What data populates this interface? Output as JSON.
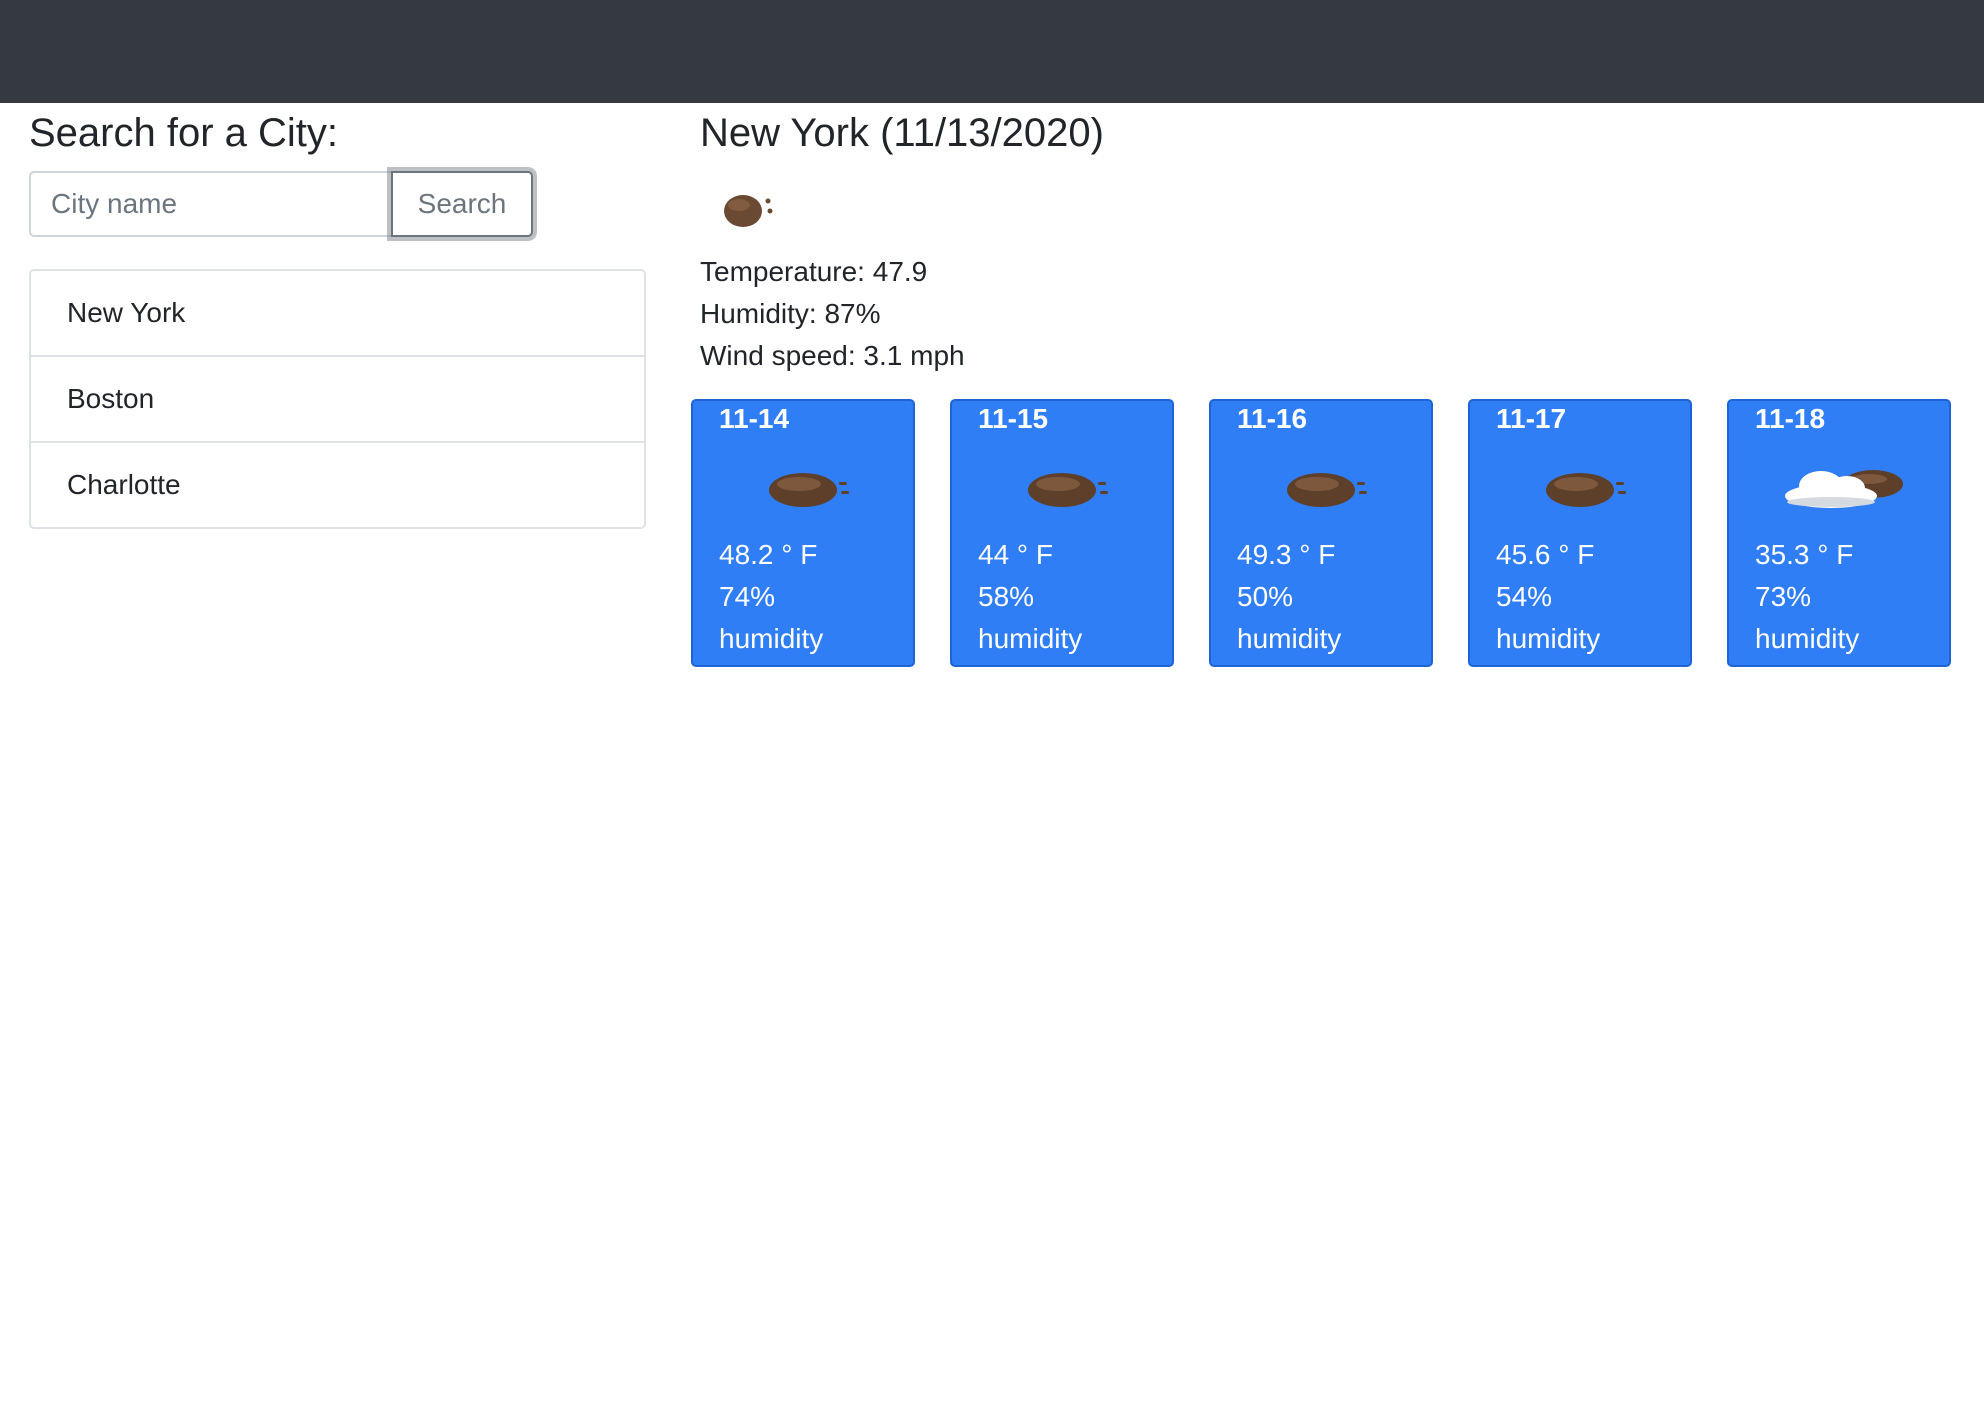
{
  "search": {
    "heading": "Search for a City:",
    "placeholder": "City name",
    "button_label": "Search"
  },
  "history": [
    "New York",
    "Boston",
    "Charlotte"
  ],
  "current": {
    "title": "New York (11/13/2020)",
    "icon": "cloud-icon",
    "temperature": "Temperature: 47.9",
    "humidity": "Humidity: 87%",
    "wind": "Wind speed: 3.1 mph"
  },
  "forecast": [
    {
      "date": "11-14",
      "temp": "48.2 ° F",
      "humidity": "74%",
      "humidity_label": "humidity",
      "icon": "cloud-icon"
    },
    {
      "date": "11-15",
      "temp": "44 ° F",
      "humidity": "58%",
      "humidity_label": "humidity",
      "icon": "cloud-icon"
    },
    {
      "date": "11-16",
      "temp": "49.3 ° F",
      "humidity": "50%",
      "humidity_label": "humidity",
      "icon": "cloud-icon"
    },
    {
      "date": "11-17",
      "temp": "45.6 ° F",
      "humidity": "54%",
      "humidity_label": "humidity",
      "icon": "cloud-icon"
    },
    {
      "date": "11-18",
      "temp": "35.3 ° F",
      "humidity": "73%",
      "humidity_label": "humidity",
      "icon": "partly-cloudy-icon"
    }
  ],
  "colors": {
    "navbar": "#343a40",
    "card": "#2f7ef6"
  }
}
